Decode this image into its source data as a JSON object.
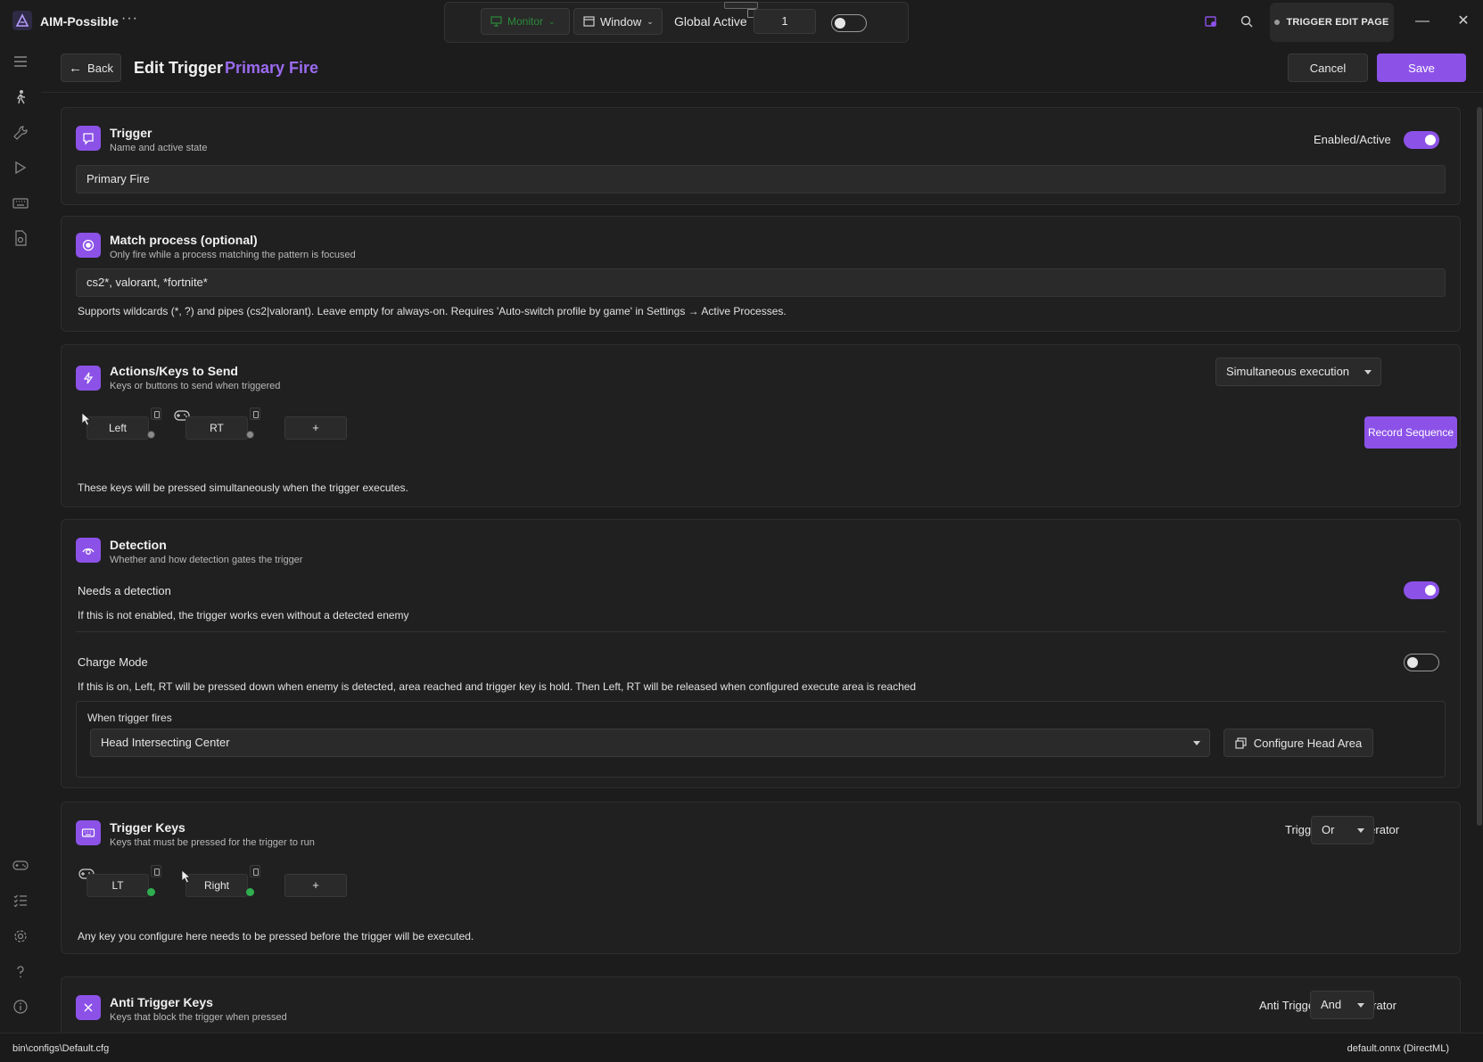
{
  "app": {
    "name": "AIM-Possible",
    "more": "···"
  },
  "topbar": {
    "monitor_label": "Monitor",
    "window_label": "Window",
    "global_active_label": "Global Active",
    "global_active_value": "1",
    "page_badge": "TRIGGER EDIT PAGE"
  },
  "header": {
    "back_label": "Back",
    "title": "Edit Trigger",
    "trigger_name": "Primary Fire",
    "cancel_label": "Cancel",
    "save_label": "Save"
  },
  "trigger_card": {
    "title": "Trigger",
    "subtitle": "Name and active state",
    "enabled_label": "Enabled/Active",
    "name_value": "Primary Fire"
  },
  "process_card": {
    "title": "Match process (optional)",
    "subtitle": "Only fire while a process matching the pattern is focused",
    "pattern_value": "cs2*, valorant, *fortnite*",
    "helper": "Supports wildcards (*, ?) and pipes (cs2|valorant). Leave empty for always-on. Requires 'Auto-switch profile by game' in Settings → Active Processes."
  },
  "actions_card": {
    "title": "Actions/Keys to Send",
    "subtitle": "Keys or buttons to send when triggered",
    "mode_value": "Simultaneous execution",
    "keys": [
      "Left",
      "RT"
    ],
    "add_label": "+",
    "record_label": "Record Sequence",
    "helper": "These keys will be pressed simultaneously when the trigger executes."
  },
  "detection_card": {
    "title": "Detection",
    "subtitle": "Whether and how detection gates the trigger",
    "needs_label": "Needs a detection",
    "needs_helper": "If this is not enabled, the trigger works even without a detected enemy",
    "charge_label": "Charge Mode",
    "charge_helper": "If this is on, Left, RT will be pressed down when enemy is detected, area reached and trigger key is hold. Then Left, RT will be released when configured execute area is reached",
    "when_label": "When trigger fires",
    "when_value": "Head Intersecting Center",
    "configure_label": "Configure Head Area"
  },
  "trigger_keys_card": {
    "title": "Trigger Keys",
    "subtitle": "Keys that must be pressed for the trigger to run",
    "operator_label": "Trigger Keys Operator",
    "operator_value": "Or",
    "keys": [
      "LT",
      "Right"
    ],
    "add_label": "+",
    "helper": "Any key you configure here needs to be pressed before the trigger will be executed."
  },
  "anti_card": {
    "title": "Anti Trigger Keys",
    "subtitle": "Keys that block the trigger when pressed",
    "operator_label": "Anti Trigger Keys Operator",
    "operator_value": "And"
  },
  "status": {
    "config_path": "bin\\configs\\Default.cfg",
    "model": "default.onnx (DirectML)"
  },
  "colors": {
    "accent": "#8c52e8",
    "accent_text": "#9b6bf0",
    "success": "#2fae4f"
  }
}
